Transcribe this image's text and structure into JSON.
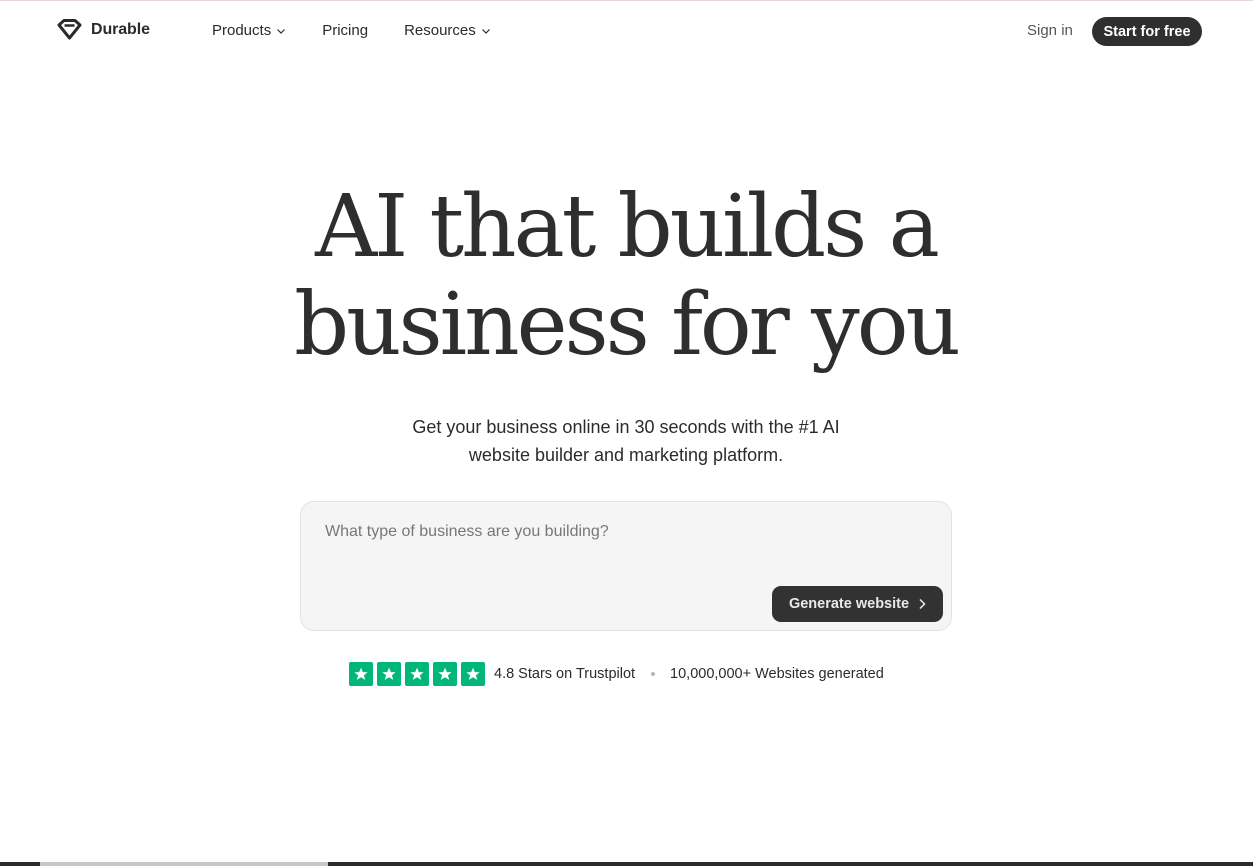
{
  "brand": {
    "name": "Durable",
    "logo_icon": "diamond-logo-icon"
  },
  "nav": {
    "items": [
      {
        "label": "Products",
        "has_dropdown": true
      },
      {
        "label": "Pricing",
        "has_dropdown": false
      },
      {
        "label": "Resources",
        "has_dropdown": true
      }
    ],
    "sign_in": "Sign in",
    "cta": "Start for free"
  },
  "hero": {
    "title_line1": "AI that builds a",
    "title_line2": "business for you",
    "subtitle_line1": "Get your business online in 30 seconds with the #1 AI",
    "subtitle_line2": "website builder and marketing platform."
  },
  "prompt": {
    "placeholder": "What type of business are you building?",
    "value": "",
    "button_label": "Generate website"
  },
  "social_proof": {
    "stars": 5,
    "rating_text": "4.8 Stars on Trustpilot",
    "count_text": "10,000,000+ Websites generated"
  },
  "colors": {
    "text": "#2b2b2b",
    "button_dark": "#2f2f2f",
    "trustpilot_green": "#00b67a",
    "prompt_bg": "#f5f5f5"
  }
}
